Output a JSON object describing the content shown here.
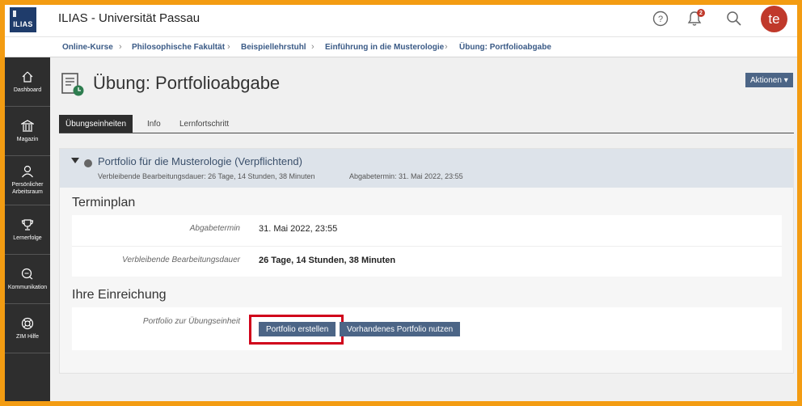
{
  "header": {
    "logo_text": "ILIAS",
    "app_title": "ILIAS - Universität Passau",
    "notification_count": "2",
    "avatar_initials": "te",
    "icons": [
      "help-icon",
      "bell-icon",
      "search-icon"
    ]
  },
  "breadcrumb": [
    {
      "label": "Online-Kurse"
    },
    {
      "label": "Philosophische Fakultät"
    },
    {
      "label": "Beispiellehrstuhl"
    },
    {
      "label": "Einführung in die Musterologie"
    },
    {
      "label": "Übung: Portfolioabgabe"
    }
  ],
  "sidebar": {
    "items": [
      {
        "label": "Dashboard",
        "icon": "dashboard-icon"
      },
      {
        "label": "Magazin",
        "icon": "library-icon"
      },
      {
        "label": "Persönlicher\nArbeitsraum",
        "icon": "user-icon"
      },
      {
        "label": "Lernerfolge",
        "icon": "trophy-icon"
      },
      {
        "label": "Kommunikation",
        "icon": "chat-icon"
      },
      {
        "label": "ZIM Hilfe",
        "icon": "lifebuoy-icon"
      }
    ]
  },
  "page": {
    "title": "Übung: Portfolioabgabe",
    "actions_label": "Aktionen ▾"
  },
  "tabs": [
    {
      "label": "Übungseinheiten",
      "active": true
    },
    {
      "label": "Info",
      "active": false
    },
    {
      "label": "Lernfortschritt",
      "active": false
    }
  ],
  "assignment": {
    "title": "Portfolio für die Musterologie (Verpflichtend)",
    "remaining": "Verbleibende Bearbeitungsdauer: 26 Tage, 14 Stunden, 38 Minuten",
    "deadline": "Abgabetermin: 31. Mai 2022, 23:55"
  },
  "schedule": {
    "title": "Terminplan",
    "rows": [
      {
        "label": "Abgabetermin",
        "value": "31. Mai 2022, 23:55"
      },
      {
        "label": "Verbleibende Bearbeitungsdauer",
        "value": "26 Tage, 14 Stunden, 38 Minuten"
      }
    ]
  },
  "submission": {
    "title": "Ihre Einreichung",
    "label": "Portfolio zur Übungseinheit",
    "create_button": "Portfolio erstellen",
    "use_existing_button": "Vorhandenes Portfolio nutzen"
  },
  "colors": {
    "border_accent": "#f39c12",
    "primary_button": "#4c6586",
    "highlight": "#d0021b",
    "sidebar_bg": "#2e2e2e"
  }
}
